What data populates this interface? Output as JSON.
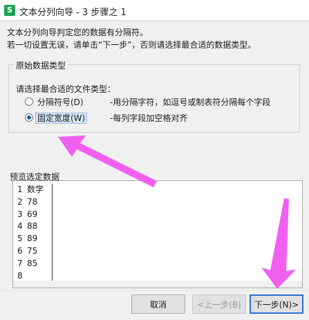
{
  "window": {
    "app_icon_letter": "S",
    "title": "文本分列向导 - 3 步骤之 1"
  },
  "intro": {
    "line1": "文本分列向导判定您的数据有分隔符。",
    "line2": "若一切设置无误，请单击“下一步”，否则请选择最合适的数据类型。"
  },
  "data_type_group": {
    "legend": "原始数据类型",
    "prompt": "请选择最合适的文件类型：",
    "options": [
      {
        "label": "分隔符号(D)",
        "desc": "-用分隔字符，如逗号或制表符分隔每个字段",
        "selected": false
      },
      {
        "label": "固定宽度(W)",
        "desc": "-每列字段加空格对齐",
        "selected": true
      }
    ]
  },
  "preview": {
    "label": "预览选定数据",
    "row_numbers": [
      "1",
      "2",
      "3",
      "4",
      "5",
      "6",
      "7",
      "8"
    ],
    "values": [
      "数学",
      "78",
      "69",
      "88",
      "89",
      "75",
      "85",
      ""
    ]
  },
  "buttons": {
    "cancel": "取消",
    "back": "<上一步(B)",
    "next": "下一步(N)>"
  },
  "colors": {
    "annotation_arrow": "#f056f0",
    "selected_radio": "#1e5fb3",
    "focus_border": "#2b6fd0"
  }
}
